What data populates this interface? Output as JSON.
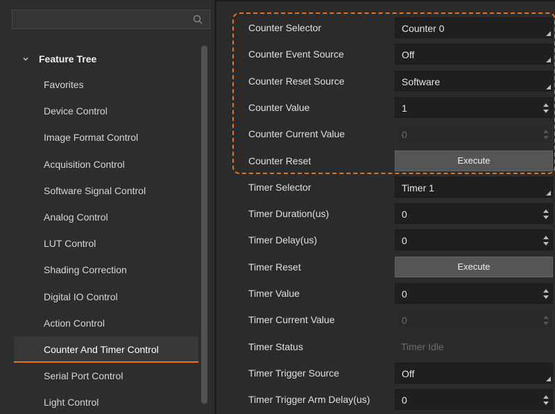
{
  "search": {
    "placeholder": ""
  },
  "tree": {
    "header": "Feature Tree",
    "items": [
      {
        "label": "Favorites",
        "selected": false
      },
      {
        "label": "Device Control",
        "selected": false
      },
      {
        "label": "Image Format Control",
        "selected": false
      },
      {
        "label": "Acquisition Control",
        "selected": false
      },
      {
        "label": "Software Signal Control",
        "selected": false
      },
      {
        "label": "Analog Control",
        "selected": false
      },
      {
        "label": "LUT Control",
        "selected": false
      },
      {
        "label": "Shading Correction",
        "selected": false
      },
      {
        "label": "Digital IO Control",
        "selected": false
      },
      {
        "label": "Action Control",
        "selected": false
      },
      {
        "label": "Counter And Timer Control",
        "selected": true
      },
      {
        "label": "Serial Port Control",
        "selected": false
      },
      {
        "label": "Light Control",
        "selected": false
      }
    ]
  },
  "properties": [
    {
      "label": "Counter Selector",
      "kind": "dropdown",
      "value": "Counter 0"
    },
    {
      "label": "Counter Event Source",
      "kind": "dropdown",
      "value": "Off"
    },
    {
      "label": "Counter Reset Source",
      "kind": "dropdown",
      "value": "Software"
    },
    {
      "label": "Counter Value",
      "kind": "spin",
      "value": "1"
    },
    {
      "label": "Counter Current Value",
      "kind": "spin-disabled",
      "value": "0"
    },
    {
      "label": "Counter Reset",
      "kind": "button",
      "value": "Execute"
    },
    {
      "label": "Timer Selector",
      "kind": "dropdown",
      "value": "Timer 1"
    },
    {
      "label": "Timer Duration(us)",
      "kind": "spin",
      "value": "0"
    },
    {
      "label": "Timer Delay(us)",
      "kind": "spin",
      "value": "0"
    },
    {
      "label": "Timer Reset",
      "kind": "button",
      "value": "Execute"
    },
    {
      "label": "Timer Value",
      "kind": "spin",
      "value": "0"
    },
    {
      "label": "Timer Current Value",
      "kind": "spin-disabled",
      "value": "0"
    },
    {
      "label": "Timer Status",
      "kind": "readonly",
      "value": "Timer Idle"
    },
    {
      "label": "Timer Trigger Source",
      "kind": "dropdown",
      "value": "Off"
    },
    {
      "label": "Timer Trigger Arm Delay(us)",
      "kind": "spin",
      "value": "0"
    }
  ],
  "colors": {
    "accent": "#e8731a",
    "panel": "#2d2d2d",
    "field": "#1f1f1f",
    "button": "#555555"
  }
}
